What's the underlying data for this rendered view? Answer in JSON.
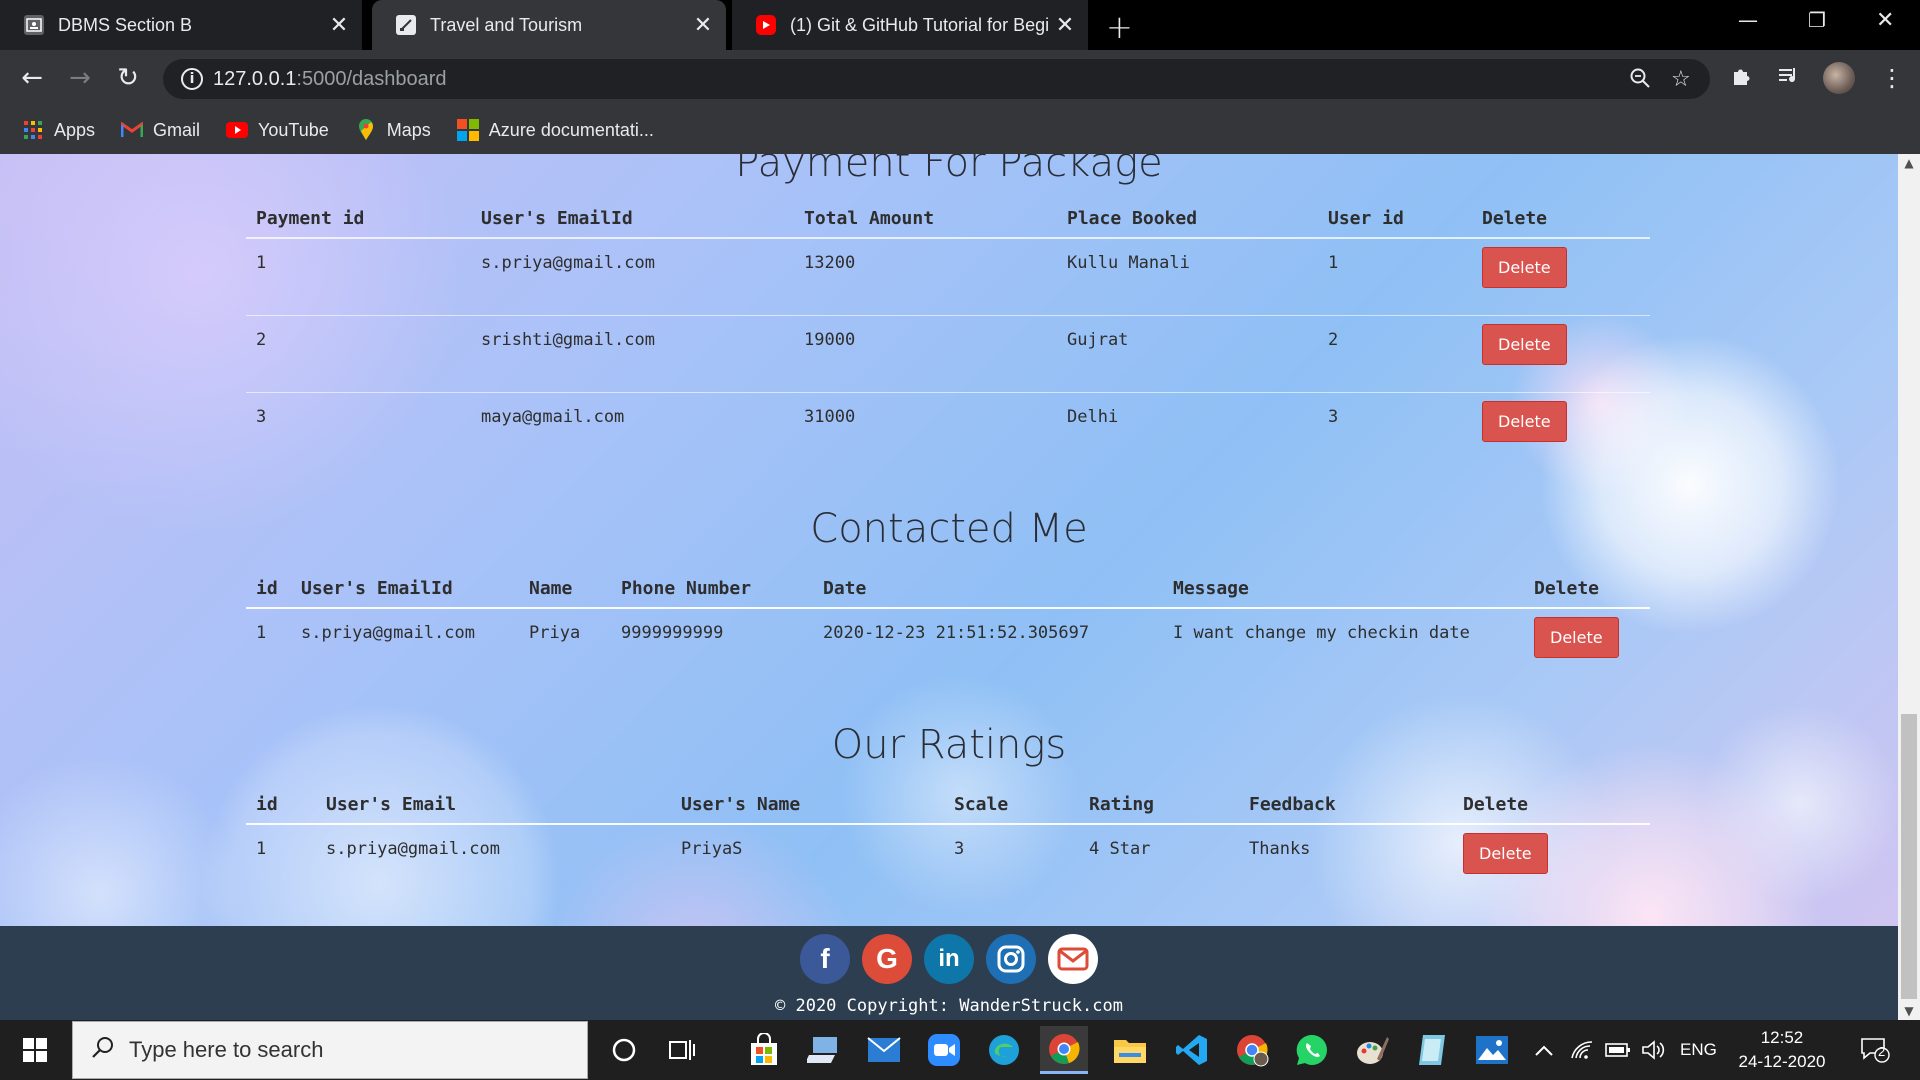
{
  "browser": {
    "tabs": [
      {
        "title": "DBMS Section B",
        "active": false,
        "icon": "classroom-icon"
      },
      {
        "title": "Travel and Tourism",
        "active": true,
        "icon": "page-icon"
      },
      {
        "title": "(1) Git & GitHub Tutorial for Begi",
        "active": false,
        "icon": "youtube-icon"
      }
    ],
    "url_host": "127.0.0.1",
    "url_path": ":5000/dashboard",
    "bookmarks": [
      {
        "label": "Apps",
        "icon": "apps-grid-icon"
      },
      {
        "label": "Gmail",
        "icon": "gmail-icon"
      },
      {
        "label": "YouTube",
        "icon": "youtube-icon"
      },
      {
        "label": "Maps",
        "icon": "maps-pin-icon"
      },
      {
        "label": "Azure documentati...",
        "icon": "windows-logo-icon"
      }
    ]
  },
  "page": {
    "payment": {
      "title": "Payment For Package",
      "headers": [
        "Payment id",
        "User's EmailId",
        "Total Amount",
        "Place Booked",
        "User id",
        "Delete"
      ],
      "rows": [
        [
          "1",
          "s.priya@gmail.com",
          "13200",
          "Kullu Manali",
          "1"
        ],
        [
          "2",
          "srishti@gmail.com",
          "19000",
          "Gujrat",
          "2"
        ],
        [
          "3",
          "maya@gmail.com",
          "31000",
          "Delhi",
          "3"
        ]
      ]
    },
    "contact": {
      "title": "Contacted Me",
      "headers": [
        "id",
        "User's EmailId",
        "Name",
        "Phone Number",
        "Date",
        "Message",
        "Delete"
      ],
      "rows": [
        [
          "1",
          "s.priya@gmail.com",
          "Priya",
          "9999999999",
          "2020-12-23 21:51:52.305697",
          "I want change my checkin date"
        ]
      ]
    },
    "ratings": {
      "title": "Our Ratings",
      "headers": [
        "id",
        "User's Email",
        "User's Name",
        "Scale",
        "Rating",
        "Feedback",
        "Delete"
      ],
      "rows": [
        [
          "1",
          "s.priya@gmail.com",
          "PriyaS",
          "3",
          "4 Star",
          "Thanks"
        ]
      ]
    },
    "delete_label": "Delete",
    "footer": {
      "social": [
        {
          "glyph": "f",
          "icon": "facebook-icon",
          "color": "#3b5998"
        },
        {
          "glyph": "G",
          "icon": "google-icon",
          "color": "#dd4b39"
        },
        {
          "glyph": "in",
          "icon": "linkedin-icon",
          "color": "#0e76a8"
        },
        {
          "glyph": "◎",
          "icon": "instagram-icon",
          "color": "#1f6fb5"
        },
        {
          "glyph": "✉",
          "icon": "email-icon",
          "color": "#ffffff"
        }
      ],
      "copyright": "© 2020 Copyright: WanderStruck.com"
    }
  },
  "taskbar": {
    "search_placeholder": "Type here to search",
    "language": "ENG",
    "time": "12:52",
    "date": "24-12-2020",
    "notification_count": "2"
  }
}
